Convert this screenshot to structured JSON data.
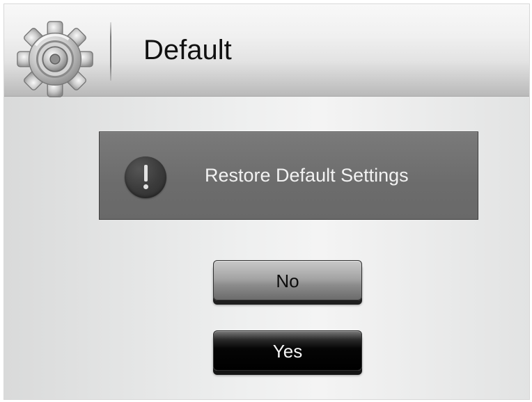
{
  "header": {
    "title": "Default",
    "icon": "gear-icon"
  },
  "dialog": {
    "icon": "exclamation-icon",
    "message": "Restore Default Settings"
  },
  "buttons": {
    "no_label": "No",
    "yes_label": "Yes"
  },
  "colors": {
    "screen_background": "#e9e9e9",
    "alert_panel": "#6f6f6f",
    "alert_text": "#f2f2f2",
    "no_button": "#9a9a9a",
    "yes_button": "#050505"
  }
}
